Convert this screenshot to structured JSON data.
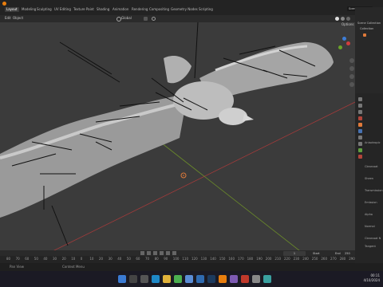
{
  "workspace_tabs": [
    "Layout",
    "Modeling",
    "Sculpting",
    "UV Editing",
    "Texture Paint",
    "Shading",
    "Animation",
    "Rendering",
    "Compositing",
    "Geometry Nodes",
    "Scripting"
  ],
  "active_tab": "Layout",
  "header": {
    "edit": "Edit",
    "object": "Object",
    "transform_orientation": "Global",
    "options": "Options",
    "scene": "Scene"
  },
  "outliner": {
    "rows": [
      "Scene Collection",
      "Collection"
    ]
  },
  "properties": {
    "labels": [
      "Anisotropic",
      "Clearcoat",
      "Sheen",
      "Transmission",
      "Emission",
      "Alpha",
      "Normal",
      "Clearcoat N",
      "Tangent"
    ]
  },
  "timeline": {
    "frame_label": "Start",
    "start": "1",
    "end_label": "End",
    "end": "250",
    "frames": [
      "80",
      "70",
      "60",
      "50",
      "40",
      "30",
      "20",
      "10",
      "0",
      "10",
      "20",
      "30",
      "40",
      "50",
      "60",
      "70",
      "80",
      "90",
      "100",
      "110",
      "120",
      "130",
      "140",
      "150",
      "160",
      "170",
      "180",
      "190",
      "200",
      "210",
      "220",
      "230",
      "240",
      "250",
      "260",
      "270",
      "280",
      "290"
    ]
  },
  "status": {
    "left": "Pan View",
    "mid": "Context Menu"
  },
  "taskbar_time": {
    "time": "00:11",
    "date": "4/10/2024"
  },
  "colors": {
    "viewport_bg": "#3b3b3b",
    "accent": "#4772b3",
    "x_axis": "#a23b3b",
    "y_axis": "#6a8a2a"
  }
}
